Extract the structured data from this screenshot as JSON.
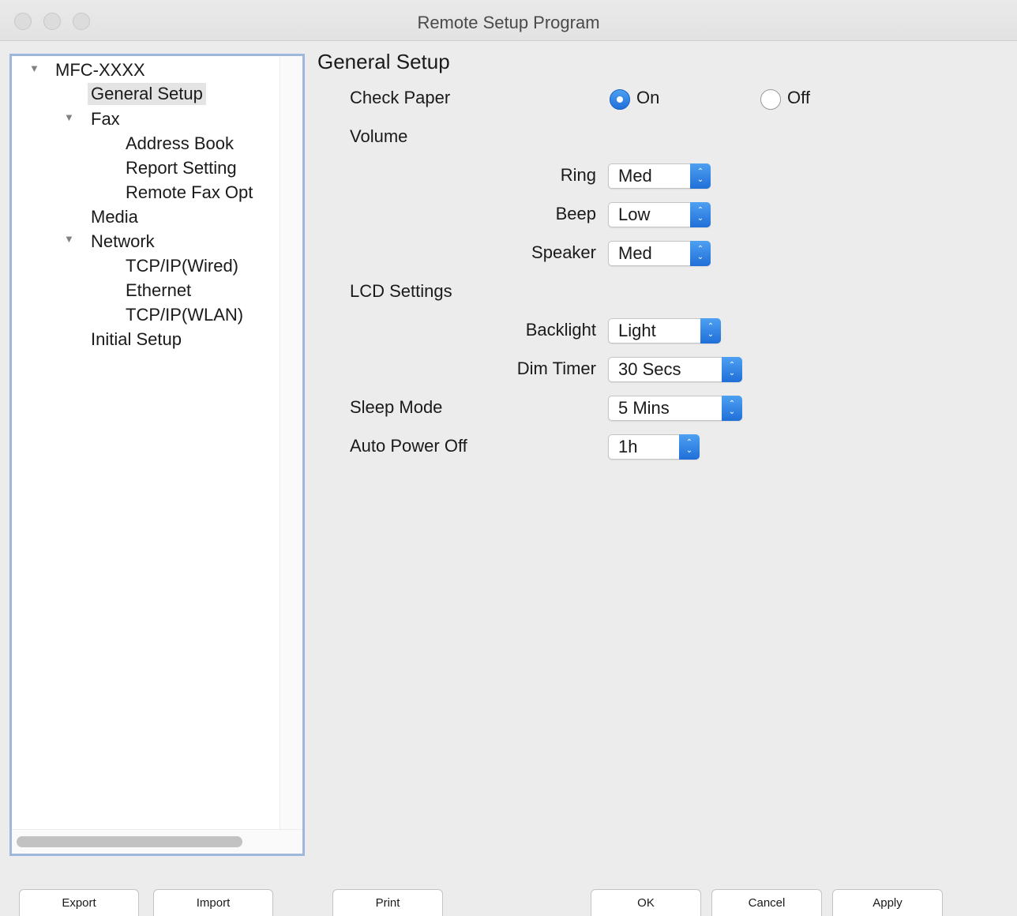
{
  "window": {
    "title": "Remote Setup Program"
  },
  "sidebar": {
    "items": [
      {
        "label": "MFC-XXXX",
        "expanded": true
      },
      {
        "label": "General Setup",
        "selected": true
      },
      {
        "label": "Fax",
        "expanded": true
      },
      {
        "label": "Address Book"
      },
      {
        "label": "Report Setting"
      },
      {
        "label": "Remote Fax Opt"
      },
      {
        "label": "Media"
      },
      {
        "label": "Network",
        "expanded": true
      },
      {
        "label": "TCP/IP(Wired)"
      },
      {
        "label": "Ethernet"
      },
      {
        "label": "TCP/IP(WLAN)"
      },
      {
        "label": "Initial Setup"
      }
    ]
  },
  "main": {
    "section_title": "General Setup",
    "check_paper": {
      "label": "Check Paper",
      "options": [
        "On",
        "Off"
      ],
      "selected": "On"
    },
    "volume": {
      "label": "Volume",
      "ring": {
        "label": "Ring",
        "value": "Med"
      },
      "beep": {
        "label": "Beep",
        "value": "Low"
      },
      "speaker": {
        "label": "Speaker",
        "value": "Med"
      }
    },
    "lcd_settings": {
      "label": "LCD Settings",
      "backlight": {
        "label": "Backlight",
        "value": "Light"
      },
      "dim_timer": {
        "label": "Dim Timer",
        "value": "30 Secs"
      }
    },
    "sleep_mode": {
      "label": "Sleep Mode",
      "value": "5 Mins"
    },
    "auto_power_off": {
      "label": "Auto Power Off",
      "value": "1h"
    }
  },
  "buttons": {
    "export": "Export",
    "import": "Import",
    "print": "Print",
    "ok": "OK",
    "cancel": "Cancel",
    "apply": "Apply"
  },
  "colors": {
    "accent": "#1f6fd8",
    "sidebar_border": "#9fb7dd",
    "selection": "#e4e4e4"
  }
}
